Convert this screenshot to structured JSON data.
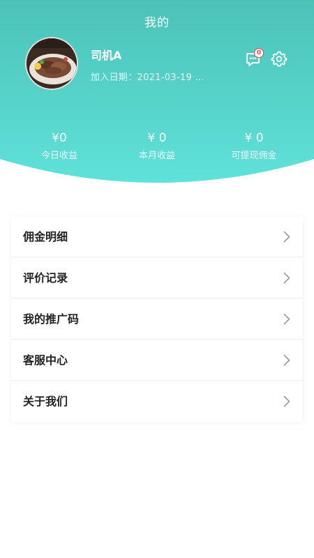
{
  "header": {
    "title": "我的",
    "gradient_top": "#4cc4b8",
    "gradient_bottom": "#5ee0d8"
  },
  "profile": {
    "name": "司机A",
    "join_date": "加入日期：2021-03-19 ..."
  },
  "notifications": {
    "unread_count": "0",
    "badge_color": "#f0484b"
  },
  "stats": [
    {
      "value": "¥0",
      "label": "今日收益"
    },
    {
      "value": "¥ 0",
      "label": "本月收益"
    },
    {
      "value": "¥ 0",
      "label": "可提现佣金"
    }
  ],
  "menu": [
    {
      "label": "佣金明细",
      "name": "menu-item-commission-detail"
    },
    {
      "label": "评价记录",
      "name": "menu-item-review-records"
    },
    {
      "label": "我的推广码",
      "name": "menu-item-promo-code"
    },
    {
      "label": "客服中心",
      "name": "menu-item-customer-service"
    },
    {
      "label": "关于我们",
      "name": "menu-item-about-us"
    }
  ],
  "icons": {
    "message": "message-icon",
    "settings": "gear-icon",
    "chevron": "chevron-right-icon"
  }
}
